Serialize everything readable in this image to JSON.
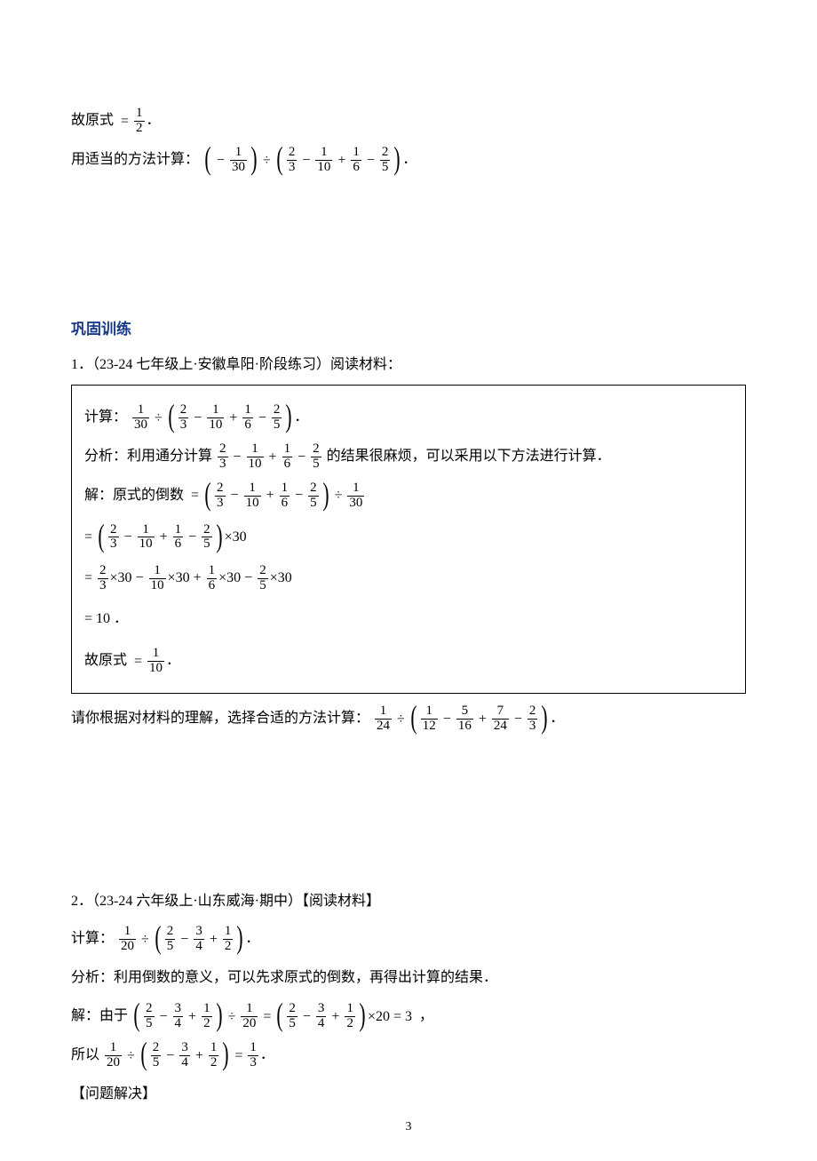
{
  "top": {
    "therefore_prefix": "故原式",
    "eq": "=",
    "frac": {
      "num": "1",
      "den": "2"
    },
    "period": "．",
    "instruction_prefix": "用适当的方法计算：",
    "expr": {
      "neg": "−",
      "frac_a": {
        "num": "1",
        "den": "30"
      },
      "div": "÷",
      "frac_b": {
        "num": "2",
        "den": "3"
      },
      "minus": "−",
      "frac_c": {
        "num": "1",
        "den": "10"
      },
      "plus": "+",
      "frac_d": {
        "num": "1",
        "den": "6"
      },
      "frac_e": {
        "num": "2",
        "den": "5"
      }
    }
  },
  "section_heading": "巩固训练",
  "p1": {
    "header": "1．（23-24 七年级上·安徽阜阳·阶段练习）阅读材料：",
    "calc_label": "计算：",
    "expr1": {
      "frac_a": {
        "num": "1",
        "den": "30"
      },
      "div": "÷",
      "frac_b": {
        "num": "2",
        "den": "3"
      },
      "minus": "−",
      "frac_c": {
        "num": "1",
        "den": "10"
      },
      "plus": "+",
      "frac_d": {
        "num": "1",
        "den": "6"
      },
      "frac_e": {
        "num": "2",
        "den": "5"
      }
    },
    "analysis_prefix": "分析：利用通分计算",
    "analysis_suffix": "的结果很麻烦，可以采用以下方法进行计算．",
    "solution_label": "解：原式的倒数",
    "step1_frac": {
      "num": "1",
      "den": "30"
    },
    "step2_times30": "×30",
    "step3": {
      "t": "×30",
      "f1": {
        "num": "2",
        "den": "3"
      },
      "f2": {
        "num": "1",
        "den": "10"
      },
      "f3": {
        "num": "1",
        "den": "6"
      },
      "f4": {
        "num": "2",
        "den": "5"
      }
    },
    "result_10": "= 10 ．",
    "therefore_prefix": "故原式",
    "result_frac": {
      "num": "1",
      "den": "10"
    },
    "conclude_prefix": "请你根据对材料的理解，选择合适的方法计算：",
    "expr2": {
      "frac_a": {
        "num": "1",
        "den": "24"
      },
      "div": "÷",
      "frac_b": {
        "num": "1",
        "den": "12"
      },
      "minus": "−",
      "frac_c": {
        "num": "5",
        "den": "16"
      },
      "plus": "+",
      "frac_d": {
        "num": "7",
        "den": "24"
      },
      "frac_e": {
        "num": "2",
        "den": "3"
      }
    }
  },
  "p2": {
    "header": "2．（23-24 六年级上·山东威海·期中）【阅读材料】",
    "calc_label": "计算：",
    "expr1": {
      "frac_a": {
        "num": "1",
        "den": "20"
      },
      "div": "÷",
      "frac_b": {
        "num": "2",
        "den": "5"
      },
      "minus": "−",
      "frac_c": {
        "num": "3",
        "den": "4"
      },
      "plus": "+",
      "frac_d": {
        "num": "1",
        "den": "2"
      }
    },
    "analysis": "分析：利用倒数的意义，可以先求原式的倒数，再得出计算的结果．",
    "solution_label": "解：由于",
    "mid_div": "÷",
    "mid_frac": {
      "num": "1",
      "den": "20"
    },
    "mid_eq": "=",
    "times20": "×20",
    "eq3": "= 3",
    "comma": "，",
    "so_prefix": "所以",
    "result_frac": {
      "num": "1",
      "den": "3"
    },
    "period": "．",
    "problem_solving": "【问题解决】"
  },
  "page_number": "3"
}
